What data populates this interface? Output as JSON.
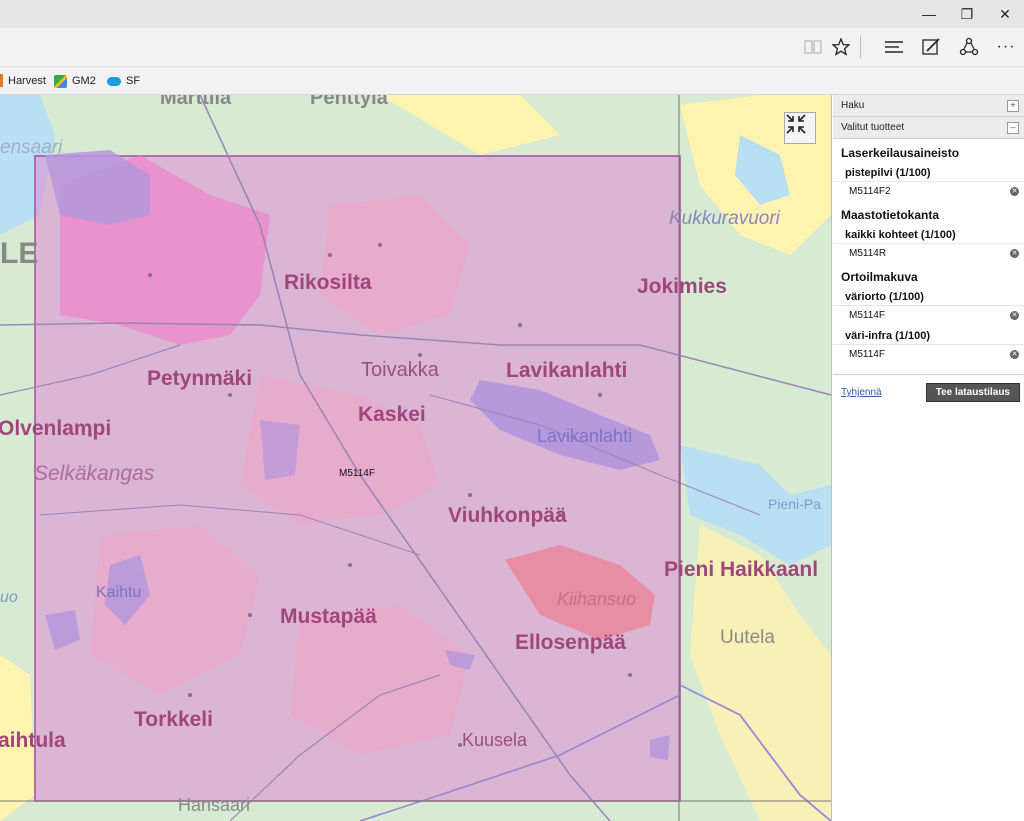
{
  "favorites": [
    {
      "label": "Harvest",
      "icon": "harvest-icon"
    },
    {
      "label": "GM2",
      "icon": "maps-icon"
    },
    {
      "label": "SF",
      "icon": "cloud-icon"
    }
  ],
  "map": {
    "place_names": [
      "Rikosilta",
      "Jokimies",
      "Petynmäki",
      "Toivakka",
      "Lavikanlahti",
      "Kaskei",
      "Olvenlampi",
      "Viuhkonpää",
      "Pieni Haikkaanl",
      "Mustapää",
      "Ellosenpää",
      "Torkkeli",
      "aihtula",
      "LE",
      "Marttila",
      "Penttyla"
    ],
    "water_names": [
      "ensaari",
      "Kukkuravuori",
      "Selkäkangas",
      "Lavikanlahti",
      "Kaihtu",
      "Kiihansuo",
      "Pieni-Pa",
      "uo"
    ],
    "town_names": [
      "Uutela",
      "Kuusela",
      "Hansaari"
    ],
    "sheet_label": "M5114F",
    "colors": {
      "selection_fill": "#e08ad6",
      "selection_border": "#b0479f",
      "water": "#b9dff3",
      "forest": "#d6ebd2",
      "field": "#fff3b0"
    }
  },
  "panel": {
    "search_title": "Haku",
    "selected_title": "Valitut tuotteet",
    "groups": [
      {
        "title": "Laserkeilausaineisto",
        "subgroups": [
          {
            "title": "pistepilvi (1/100)",
            "items": [
              "M5114F2"
            ]
          }
        ]
      },
      {
        "title": "Maastotietokanta",
        "subgroups": [
          {
            "title": "kaikki kohteet (1/100)",
            "items": [
              "M5114R"
            ]
          }
        ]
      },
      {
        "title": "Ortoilmakuva",
        "subgroups": [
          {
            "title": "väriorto (1/100)",
            "items": [
              "M5114F"
            ]
          },
          {
            "title": "väri-infra (1/100)",
            "items": [
              "M5114F"
            ]
          }
        ]
      }
    ],
    "clear_label": "Tyhjennä",
    "order_label": "Tee lataustilaus"
  }
}
